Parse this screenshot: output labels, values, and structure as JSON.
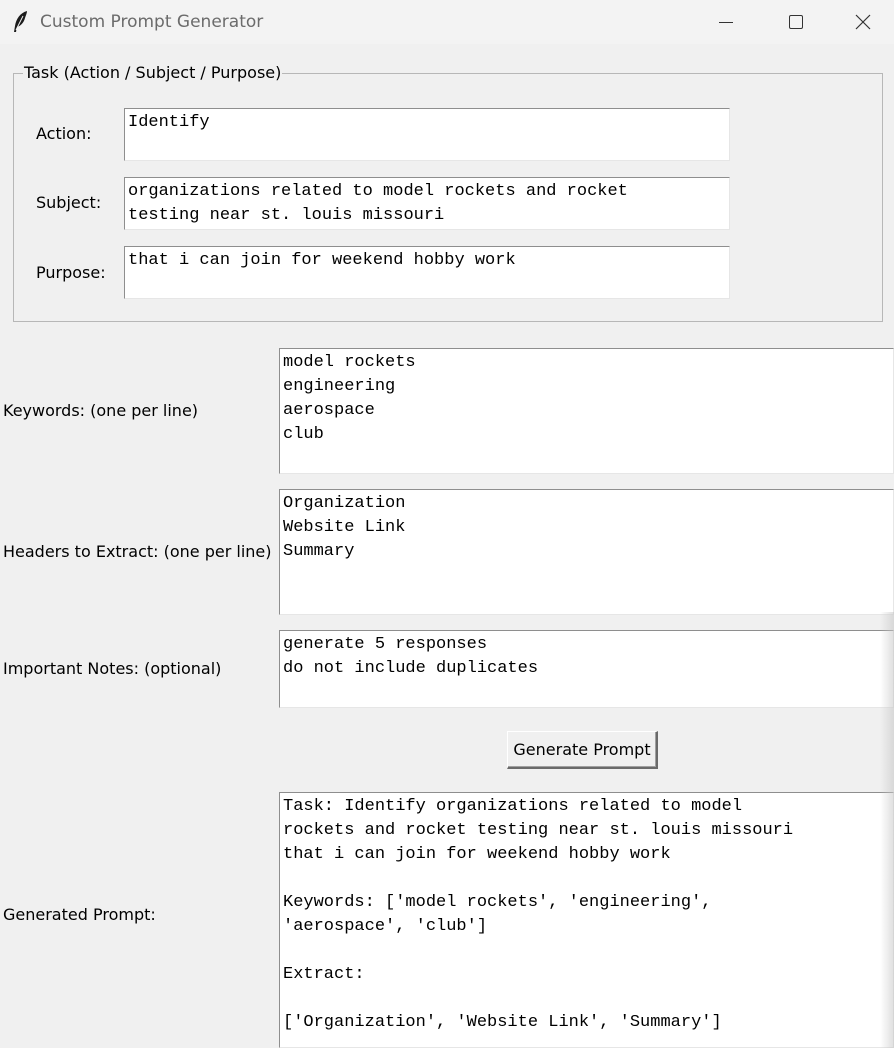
{
  "window": {
    "title": "Custom Prompt Generator",
    "icon": "feather-icon"
  },
  "task_frame": {
    "legend": "Task (Action / Subject / Purpose)",
    "action": {
      "label": "Action:",
      "value": "Identify"
    },
    "subject": {
      "label": "Subject:",
      "value": "organizations related to model rockets and rocket\ntesting near st. louis missouri"
    },
    "purpose": {
      "label": "Purpose:",
      "value": "that i can join for weekend hobby work"
    }
  },
  "keywords": {
    "label": "Keywords: (one per line)",
    "value": "model rockets\nengineering\naerospace\nclub"
  },
  "headers": {
    "label": "Headers to Extract: (one per line)",
    "value": "Organization\nWebsite Link\nSummary"
  },
  "notes": {
    "label": "Important Notes: (optional)",
    "value": "generate 5 responses\ndo not include duplicates"
  },
  "generate_button": {
    "label": "Generate Prompt"
  },
  "generated": {
    "label": "Generated Prompt:",
    "value": "Task: Identify organizations related to model\nrockets and rocket testing near st. louis missouri\nthat i can join for weekend hobby work\n\nKeywords: ['model rockets', 'engineering',\n'aerospace', 'club']\n\nExtract:\n\n['Organization', 'Website Link', 'Summary']"
  }
}
